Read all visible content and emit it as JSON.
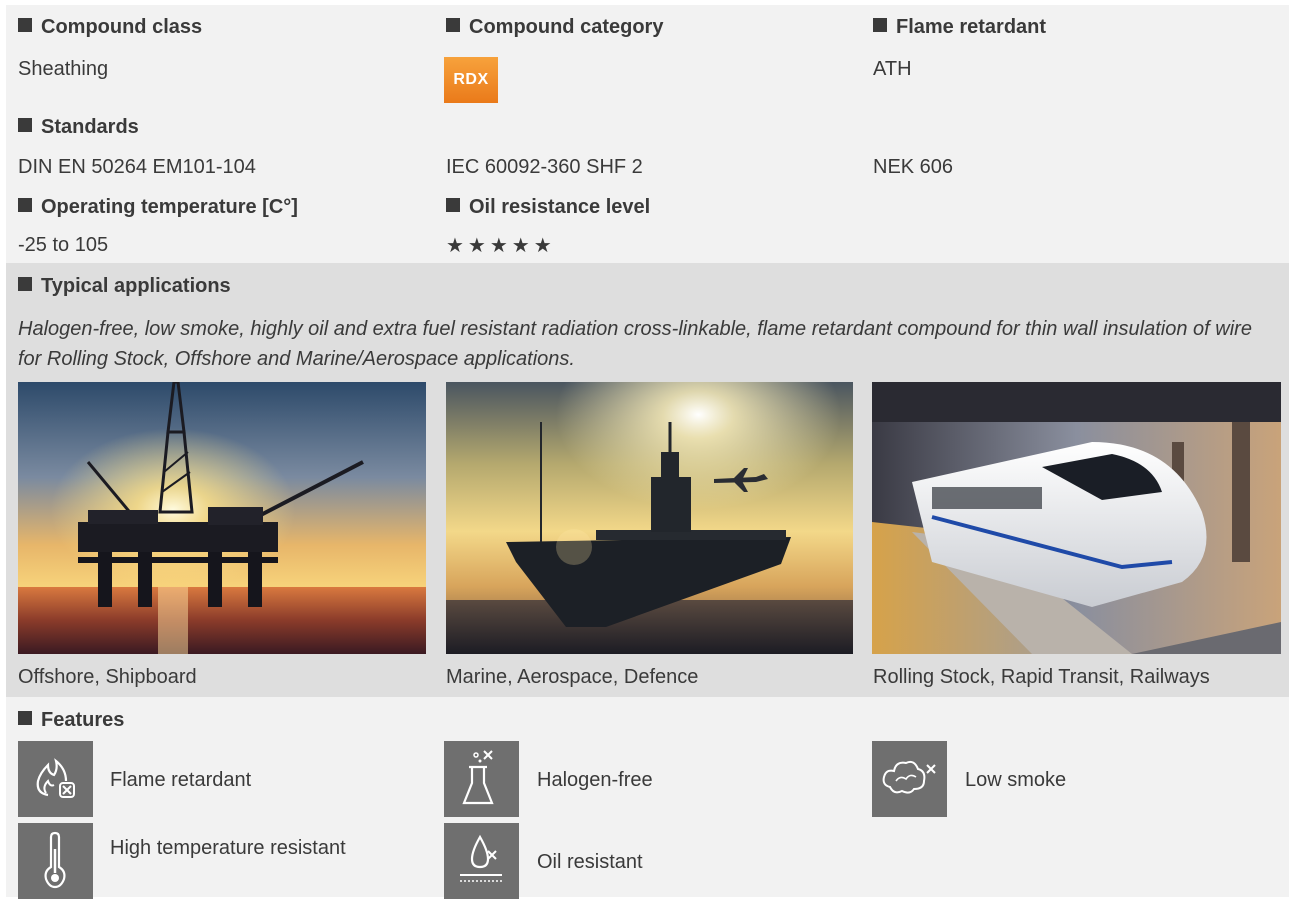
{
  "compound_class": {
    "header": "Compound class",
    "value": "Sheathing"
  },
  "compound_category": {
    "header": "Compound category",
    "badge": "RDX",
    "badge_color": "#f08c28"
  },
  "flame_retardant": {
    "header": "Flame retardant",
    "value": "ATH"
  },
  "standards": {
    "header": "Standards",
    "values": [
      "DIN EN 50264 EM101-104",
      "IEC 60092-360 SHF 2",
      "NEK 606"
    ]
  },
  "operating_temperature": {
    "header": "Operating temperature [C°]",
    "value": "-25 to 105"
  },
  "oil_resistance": {
    "header": "Oil resistance level",
    "stars": "★★★★★",
    "rating": 5,
    "max": 5
  },
  "typical_applications": {
    "header": "Typical applications",
    "description": "Halogen-free, low smoke, highly oil and extra fuel resistant radiation cross-linkable, flame retardant compound for thin wall insulation of wire for Rolling Stock, Offshore and Marine/Aerospace applications.",
    "items": [
      {
        "caption": "Offshore, Shipboard",
        "image": "offshore-platform-sunset"
      },
      {
        "caption": "Marine, Aerospace, Defence",
        "image": "aircraft-carrier-sunset"
      },
      {
        "caption": "Rolling Stock, Rapid Transit, Railways",
        "image": "high-speed-train"
      }
    ]
  },
  "features": {
    "header": "Features",
    "items": [
      {
        "label": "Flame retardant",
        "icon": "flame-icon"
      },
      {
        "label": "Halogen-free",
        "icon": "flask-icon"
      },
      {
        "label": "Low smoke",
        "icon": "smoke-cloud-icon"
      },
      {
        "label": "High temperature resistant",
        "icon": "thermometer-icon"
      },
      {
        "label": "Oil resistant",
        "icon": "oil-drop-icon"
      }
    ]
  },
  "colors": {
    "band_light": "#f2f2f2",
    "band_dark": "#dedede",
    "icon_bg": "#6f6f6f",
    "text": "#3a3a3a"
  }
}
